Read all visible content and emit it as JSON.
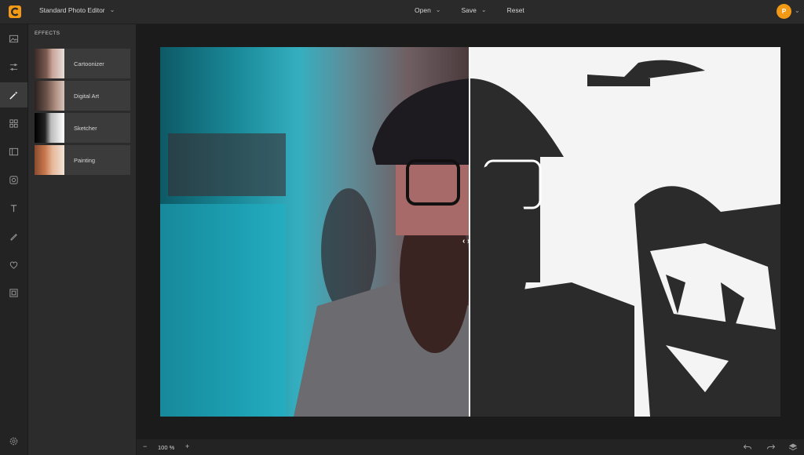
{
  "app": {
    "title": "Standard Photo Editor",
    "avatar_letter": "P",
    "brand_color": "#f29a16"
  },
  "menu": {
    "open_label": "Open",
    "save_label": "Save",
    "reset_label": "Reset"
  },
  "toolbar": {
    "items": [
      {
        "icon": "image-icon"
      },
      {
        "icon": "sliders-icon"
      },
      {
        "icon": "magic-wand-icon"
      },
      {
        "icon": "grid-icon"
      },
      {
        "icon": "frame-icon"
      },
      {
        "icon": "focus-icon"
      },
      {
        "icon": "text-icon"
      },
      {
        "icon": "brush-icon"
      },
      {
        "icon": "heart-icon"
      },
      {
        "icon": "border-icon"
      }
    ],
    "active": "magic-wand-icon"
  },
  "effects_panel": {
    "title": "EFFECTS",
    "items": [
      {
        "label": "Cartoonizer"
      },
      {
        "label": "Digital Art"
      },
      {
        "label": "Sketcher"
      },
      {
        "label": "Painting"
      }
    ]
  },
  "bottom": {
    "zoom": "100 %",
    "zoom_minus": "−",
    "zoom_plus": "+"
  }
}
